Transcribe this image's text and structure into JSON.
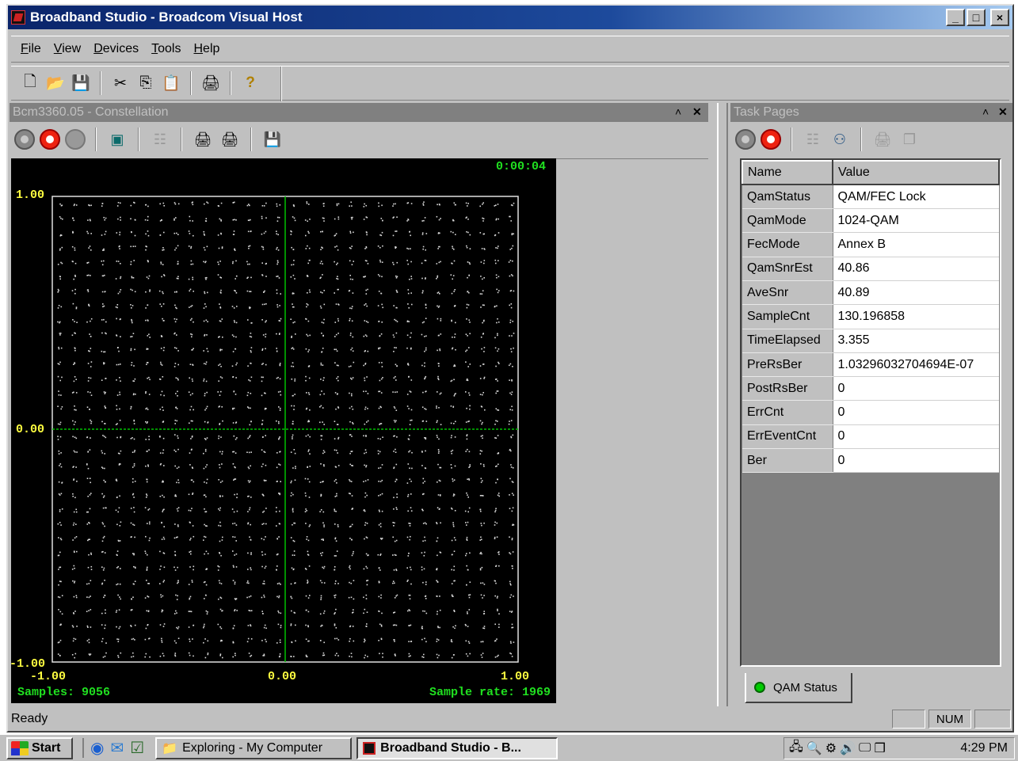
{
  "window": {
    "title": "Broadband Studio - Broadcom Visual Host",
    "controls": [
      "_",
      "□",
      "×"
    ]
  },
  "menu": [
    {
      "label": "File",
      "accel": "F"
    },
    {
      "label": "View",
      "accel": "V"
    },
    {
      "label": "Devices",
      "accel": "D"
    },
    {
      "label": "Tools",
      "accel": "T"
    },
    {
      "label": "Help",
      "accel": "H"
    }
  ],
  "toolbar_icons": [
    "new-icon",
    "open-icon",
    "save-icon",
    "cut-icon",
    "copy-icon",
    "paste-icon",
    "print-icon",
    "help-icon"
  ],
  "constellation": {
    "pane_title": "Bcm3360.05 - Constellation",
    "timer": "0:00:04",
    "y_max": "1.00",
    "y_mid": "0.00",
    "y_min": "-1.00",
    "x_min": "-1.00",
    "x_mid": "0.00",
    "x_max": "1.00",
    "samples": "Samples: 9056",
    "sample_rate": "Sample rate: 1969"
  },
  "chart_data": {
    "type": "scatter",
    "title": "",
    "xlabel": "",
    "ylabel": "",
    "xlim": [
      -1,
      1
    ],
    "ylim": [
      -1,
      1
    ],
    "grid_points_per_axis": 32,
    "modulation": "1024-QAM",
    "colors": {
      "points": "#d8d8d8",
      "axes": "#00c000",
      "frame": "#e0e0e0"
    }
  },
  "task_pages": {
    "pane_title": "Task Pages",
    "headers": {
      "name": "Name",
      "value": "Value"
    },
    "rows": [
      {
        "name": "QamStatus",
        "value": "QAM/FEC Lock"
      },
      {
        "name": "QamMode",
        "value": "1024-QAM"
      },
      {
        "name": "FecMode",
        "value": "Annex B"
      },
      {
        "name": "QamSnrEst",
        "value": "40.86"
      },
      {
        "name": "AveSnr",
        "value": "40.89"
      },
      {
        "name": "SampleCnt",
        "value": "130.196858"
      },
      {
        "name": "TimeElapsed",
        "value": "3.355"
      },
      {
        "name": "PreRsBer",
        "value": "1.03296032704694E-07"
      },
      {
        "name": "PostRsBer",
        "value": "0"
      },
      {
        "name": "ErrCnt",
        "value": "0"
      },
      {
        "name": "ErrEventCnt",
        "value": "0"
      },
      {
        "name": "Ber",
        "value": "0"
      }
    ],
    "tab_label": "QAM Status"
  },
  "status": {
    "text": "Ready",
    "num": "NUM"
  },
  "taskbar": {
    "start": "Start",
    "tasks": [
      "Exploring - My Computer",
      "Broadband Studio - B..."
    ],
    "clock": "4:29 PM"
  }
}
